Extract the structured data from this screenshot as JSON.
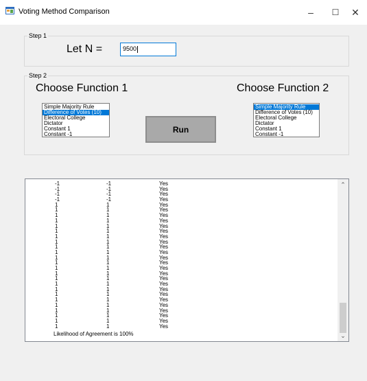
{
  "window": {
    "title": "Voting Method Comparison",
    "minimize": "–",
    "maximize": "☐",
    "close": "✕",
    "icon": "app-window-icon"
  },
  "step1": {
    "caption": "Step 1",
    "label": "Let N =",
    "n_value": "9500"
  },
  "step2": {
    "caption": "Step 2",
    "function1_title": "Choose Function 1",
    "function2_title": "Choose Function 2",
    "run_label": "Run",
    "function1_options": [
      "Simple Majority Rule",
      "Difference of Votes (10)",
      "Electoral College",
      "Dictator",
      "Constant 1",
      "Constant -1"
    ],
    "function1_selected": "Difference of Votes (10)",
    "function2_options": [
      "Simple Majority Rule",
      "Difference of Votes (10)",
      "Electoral College",
      "Dictator",
      "Constant 1",
      "Constant -1"
    ],
    "function2_selected": "Simple Majority Rule"
  },
  "output": {
    "rows": [
      [
        "-1",
        "-1",
        "Yes"
      ],
      [
        "-1",
        "-1",
        "Yes"
      ],
      [
        "-1",
        "-1",
        "Yes"
      ],
      [
        "-1",
        "-1",
        "Yes"
      ],
      [
        "1",
        "1",
        "Yes"
      ],
      [
        "1",
        "1",
        "Yes"
      ],
      [
        "1",
        "1",
        "Yes"
      ],
      [
        "1",
        "1",
        "Yes"
      ],
      [
        "1",
        "1",
        "Yes"
      ],
      [
        "1",
        "1",
        "Yes"
      ],
      [
        "1",
        "1",
        "Yes"
      ],
      [
        "1",
        "1",
        "Yes"
      ],
      [
        "1",
        "1",
        "Yes"
      ],
      [
        "1",
        "1",
        "Yes"
      ],
      [
        "1",
        "1",
        "Yes"
      ],
      [
        "1",
        "1",
        "Yes"
      ],
      [
        "1",
        "1",
        "Yes"
      ],
      [
        "1",
        "1",
        "Yes"
      ],
      [
        "1",
        "1",
        "Yes"
      ],
      [
        "1",
        "1",
        "Yes"
      ],
      [
        "1",
        "1",
        "Yes"
      ],
      [
        "1",
        "1",
        "Yes"
      ],
      [
        "1",
        "1",
        "Yes"
      ],
      [
        "1",
        "1",
        "Yes"
      ],
      [
        "1",
        "1",
        "Yes"
      ],
      [
        "1",
        "1",
        "Yes"
      ],
      [
        "1",
        "1",
        "Yes"
      ],
      [
        "1",
        "1",
        "Yes"
      ]
    ],
    "summary": "Likelihood of Agreement is 100%",
    "scroll_up": "⌃",
    "scroll_down": "⌄"
  },
  "colors": {
    "selection": "#0078d7",
    "button_face": "#a9a9a9",
    "window_bg": "#f0f0f0"
  }
}
